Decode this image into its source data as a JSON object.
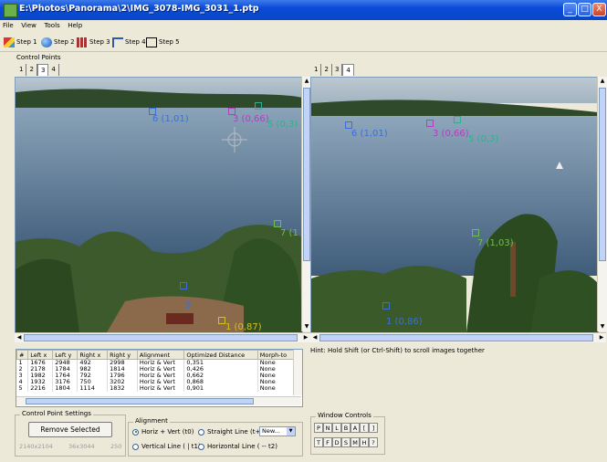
{
  "window": {
    "title": "E:\\Photos\\Panorama\\2\\IMG_3078-IMG_3031_1.ptp",
    "min": "_",
    "max": "□",
    "close": "X"
  },
  "menu": [
    "File",
    "View",
    "Tools",
    "Help"
  ],
  "toolbar": {
    "steps": [
      "Step 1",
      "Step 2",
      "Step 3",
      "Step 4",
      "Step 5"
    ]
  },
  "control_points_label": "Control Points",
  "left_tabs": [
    "1",
    "2",
    "3",
    "4"
  ],
  "right_tabs": [
    "1",
    "2",
    "3",
    "4"
  ],
  "left_points": [
    {
      "label": "6 (1,01)",
      "color": "#3a6fd8"
    },
    {
      "label": "3 (0,66)",
      "color": "#b040c0"
    },
    {
      "label": "5 (0,3)",
      "color": "#30b090"
    },
    {
      "label": "7 (1",
      "color": "#6fbf50"
    },
    {
      "label": "9",
      "color": "#3a6fd8"
    },
    {
      "label": "1 (0,87)",
      "color": "#d8c020"
    }
  ],
  "right_points": [
    {
      "label": "6 (1,01)",
      "color": "#3a6fd8"
    },
    {
      "label": "3 (0,66)",
      "color": "#b040c0"
    },
    {
      "label": "5 (0,3)",
      "color": "#30b090"
    },
    {
      "label": "7 (1,03)",
      "color": "#6fbf50"
    },
    {
      "label": "1 (0,86)",
      "color": "#3a6fd8"
    }
  ],
  "hint": "Hint: Hold Shift (or Ctrl-Shift) to scroll images together",
  "table": {
    "headers": [
      "#",
      "Left x",
      "Left y",
      "Right x",
      "Right y",
      "Alignment",
      "Optimized Distance",
      "Morph-to"
    ],
    "rows": [
      [
        "1",
        "1676",
        "2948",
        "492",
        "2998",
        "Horiz & Vert",
        "0,351",
        "None"
      ],
      [
        "2",
        "2178",
        "1784",
        "982",
        "1814",
        "Horiz & Vert",
        "0,426",
        "None"
      ],
      [
        "3",
        "1982",
        "1764",
        "792",
        "1796",
        "Horiz & Vert",
        "0,662",
        "None"
      ],
      [
        "4",
        "1932",
        "3176",
        "750",
        "3202",
        "Horiz & Vert",
        "0,868",
        "None"
      ],
      [
        "5",
        "2216",
        "1804",
        "1114",
        "1832",
        "Horiz & Vert",
        "0,901",
        "None"
      ]
    ]
  },
  "cp_settings": {
    "title": "Control Point Settings",
    "remove": "Remove Selected",
    "left_coord": "2140x2104",
    "right_coord": "36x3044",
    "extra": "250"
  },
  "alignment": {
    "title": "Alignment",
    "options": [
      "Horiz + Vert (t0)",
      "Straight Line (t+):",
      "Vertical Line ( | t1)",
      "Horizontal Line ( -- t2)"
    ],
    "selected": "Horiz + Vert (t0)",
    "new_value": "New..."
  },
  "window_controls": {
    "title": "Window Controls",
    "row1": [
      "P",
      "N",
      "L",
      "B",
      "A",
      "[",
      "]"
    ],
    "row2": [
      "T",
      "F",
      "D",
      "S",
      "M",
      "H",
      "?"
    ]
  }
}
